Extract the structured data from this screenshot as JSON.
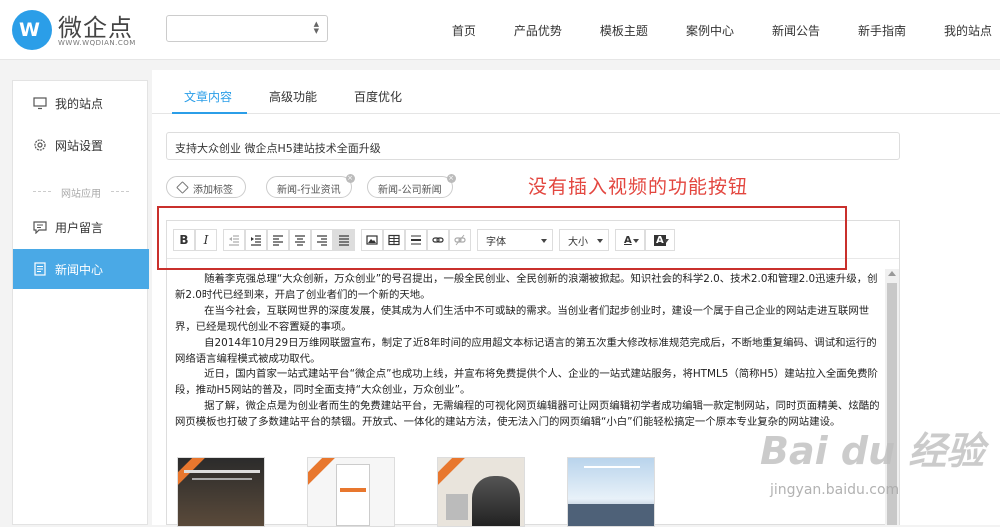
{
  "logo": {
    "name": "微企点",
    "mark": "W",
    "url": "WWW.WQDIAN.COM"
  },
  "nav": {
    "items": [
      "首页",
      "产品优势",
      "模板主题",
      "案例中心",
      "新闻公告",
      "新手指南",
      "我的站点"
    ]
  },
  "sidebar": {
    "items": [
      {
        "label": "我的站点",
        "icon": "monitor-icon"
      },
      {
        "label": "网站设置",
        "icon": "gear-icon"
      },
      {
        "label": "用户留言",
        "icon": "comment-icon"
      },
      {
        "label": "新闻中心",
        "icon": "document-icon"
      }
    ],
    "divider": "网站应用",
    "active_color": "#4aa9e6"
  },
  "tabs": {
    "items": [
      "文章内容",
      "高级功能",
      "百度优化"
    ],
    "active": 0
  },
  "article": {
    "title": "支持大众创业 微企点H5建站技术全面升级",
    "add_tag_label": "添加标签",
    "tags": [
      "新闻-行业资讯",
      "新闻-公司新闻"
    ]
  },
  "annotation": {
    "text": "没有插入视频的功能按钮",
    "color": "#e3463f"
  },
  "toolbar": {
    "buttons": [
      "B",
      "I"
    ],
    "font_label": "字体",
    "size_label": "大小",
    "color_label": "A",
    "bgcolor_label": "A"
  },
  "content": {
    "paragraphs": [
      "随着李克强总理“大众创新，万众创业”的号召提出，一般全民创业、全民创新的浪潮被掀起。知识社会的科学2.0、技术2.0和管理2.0迅速升级，创新2.0时代已经到来，开启了创业者们的一个新的天地。",
      "在当今社会，互联网世界的深度发展，使其成为人们生活中不可或缺的需求。当创业者们起步创业时，建设一个属于自己企业的网站走进互联网世界，已经是现代创业不容置疑的事项。",
      "自2014年10月29日万维网联盟宣布，制定了近8年时间的应用超文本标记语言的第五次重大修改标准规范完成后，不断地重复编码、调试和运行的网络语言编程模式被成功取代。",
      "近日，国内首家一站式建站平台“微企点”也成功上线，并宣布将免费提供个人、企业的一站式建站服务，将HTML5（简称H5）建站拉入全面免费阶段，推动H5网站的普及，同时全面支持“大众创业，万众创业”。",
      "据了解，微企点是为创业者而生的免费建站平台，无需编程的可视化网页编辑器可让网页编辑初学者成功编辑一款定制网站，同时页面精美、炫酷的网页模板也打破了多数建站平台的禁锢。开放式、一体化的建站方法，使无法入门的网页编辑“小白”们能轻松搞定一个原本专业复杂的网站建设。"
    ]
  },
  "thumbnails": {
    "count": 4
  },
  "watermark": {
    "brand": "Bai du 经验",
    "url": "jingyan.baidu.com"
  }
}
